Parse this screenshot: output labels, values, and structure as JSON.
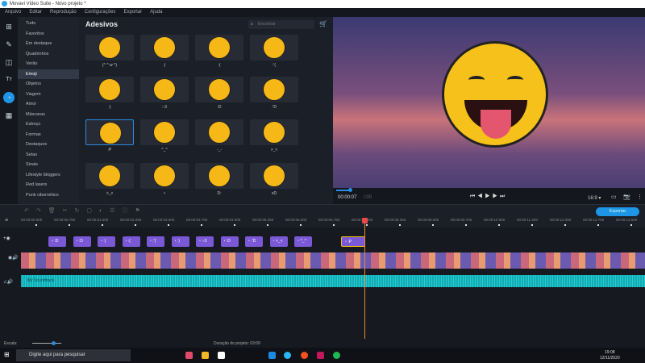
{
  "window": {
    "title": "Movavi Video Suite - Novo projeto *"
  },
  "menu": [
    "Arquivo",
    "Editar",
    "Reprodução",
    "Configurações",
    "Exportar",
    "Ajuda"
  ],
  "categories": [
    "Tudo",
    "Favoritos",
    "Em destaque",
    "Quadrinhos",
    "Verão",
    "Emoji",
    "Objetos",
    "Viagem",
    "Amor",
    "Máscaras",
    "Esboço",
    "Formas",
    "Destaques",
    "Setas",
    "Sinais",
    "Lifestyle bloggers",
    "Red lasers",
    "Punk cibernético"
  ],
  "active_category": "Emoji",
  "stickers": {
    "title": "Adesivos",
    "search_placeholder": "Encontrar",
    "items": [
      "(^ ^ w ^)",
      ":|",
      ":(",
      ":'(",
      ":)",
      ":-3",
      ":D",
      ":'D",
      ":P",
      "^_^",
      "-_-",
      ">_<",
      ">_>",
      "•",
      "D:",
      "xD"
    ],
    "selected": ":P"
  },
  "player": {
    "time": "00:00:07",
    "total": "/:00",
    "aspect": "16:9 ▾"
  },
  "toolbar": {
    "export": "Exportar"
  },
  "ruler": [
    "00:00:00.000",
    "00:00:00.750",
    "00:00:01.500",
    "00:00:02.250",
    "00:00:03.000",
    "00:00:03.750",
    "00:00:04.500",
    "00:00:05.250",
    "00:00:06.000",
    "00:00:06.750",
    "00:00:07.500",
    "00:00:08.250",
    "00:00:09.000",
    "00:00:09.750",
    "00:00:10.500",
    "00:00:11.250",
    "00:00:12.000",
    "00:00:12.750",
    "00:00:13.500"
  ],
  "clips": [
    ":D",
    ":D",
    ":|",
    ":(",
    ":'(",
    ":)",
    ":-3",
    ":D",
    ":'D",
    ">_<",
    "^_^",
    ":P"
  ],
  "audio_label": "My Soundtrack",
  "bottom": {
    "scale": "Escala:",
    "duration": "Duração do projeto: 03:09"
  },
  "taskbar": {
    "search": "Digite aqui para pesquisar",
    "time": "19:08",
    "date": "12/11/2020"
  }
}
